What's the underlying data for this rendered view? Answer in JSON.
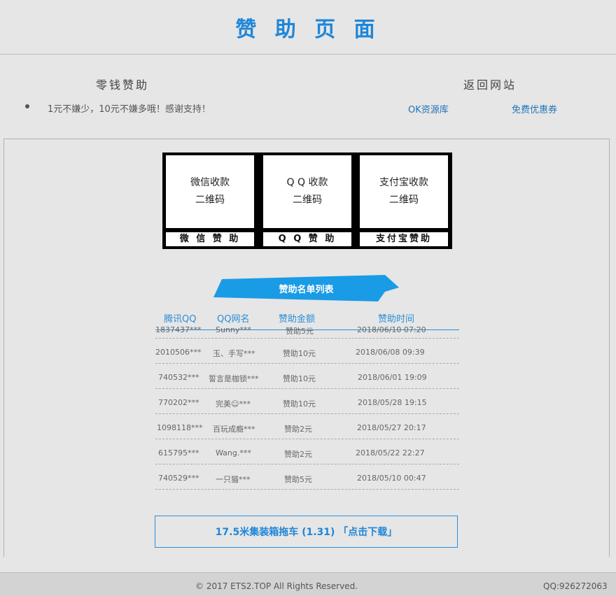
{
  "page": {
    "title": "赞 助 页 面"
  },
  "info": {
    "left_title": "零钱赞助",
    "message": "1元不嫌少，10元不嫌多哦！感谢支持！",
    "right_title": "返回网站",
    "links": [
      {
        "label": "OK资源库"
      },
      {
        "label": "免费优惠券"
      }
    ]
  },
  "qr_codes": [
    {
      "line1": "微信收款",
      "line2": "二维码",
      "label": "微 信 赞 助"
    },
    {
      "line1": "Q Q 收款",
      "line2": "二维码",
      "label": "Q Q 赞 助"
    },
    {
      "line1": "支付宝收款",
      "line2": "二维码",
      "label": "支付宝赞助"
    }
  ],
  "sponsor_list": {
    "ribbon": "赞助名单列表",
    "headers": [
      "腾讯QQ",
      "QQ网名",
      "赞助金额",
      "赞助时间"
    ],
    "rows": [
      {
        "qq": "1837437***",
        "name": "Sunny***",
        "amount": "赞助5元",
        "time": "2018/06/10 07:20"
      },
      {
        "qq": "2010506***",
        "name": "玉、手写***",
        "amount": "赞助10元",
        "time": "2018/06/08 09:39"
      },
      {
        "qq": "740532***",
        "name": "誓言是枷锁***",
        "amount": "赞助10元",
        "time": "2018/06/01 19:09"
      },
      {
        "qq": "770202***",
        "name": "完美☺***",
        "amount": "赞助10元",
        "time": "2018/05/28 19:15"
      },
      {
        "qq": "1098118***",
        "name": "百玩成瘾***",
        "amount": "赞助2元",
        "time": "2018/05/27 20:17"
      },
      {
        "qq": "615795***",
        "name": "Wang.***",
        "amount": "赞助2元",
        "time": "2018/05/22 22:27"
      },
      {
        "qq": "740529***",
        "name": "一只猫***",
        "amount": "赞助5元",
        "time": "2018/05/10 00:47"
      }
    ]
  },
  "download": {
    "label": "17.5米集装箱拖车 (1.31) 「点击下载」"
  },
  "footer": {
    "copyright": "© 2017 ETS2.TOP All Rights Reserved.",
    "qq": "QQ:926272063"
  },
  "colors": {
    "accent": "#1f86d8",
    "ribbon": "#1a9be6",
    "background": "#e6e6e6"
  }
}
